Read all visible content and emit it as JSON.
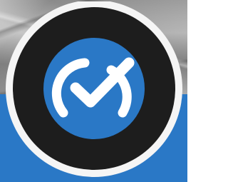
{
  "scene": {
    "background_photo": "textured-gray-photo",
    "bottom_band_color": "#2a78c6"
  },
  "badge": {
    "icon": "checkmark-gauge-icon",
    "outer_ring_color": "#f5f5f5",
    "dark_ring_color": "#1d1d1d",
    "inner_circle_color": "#2a78c6",
    "icon_color": "#ffffff"
  }
}
